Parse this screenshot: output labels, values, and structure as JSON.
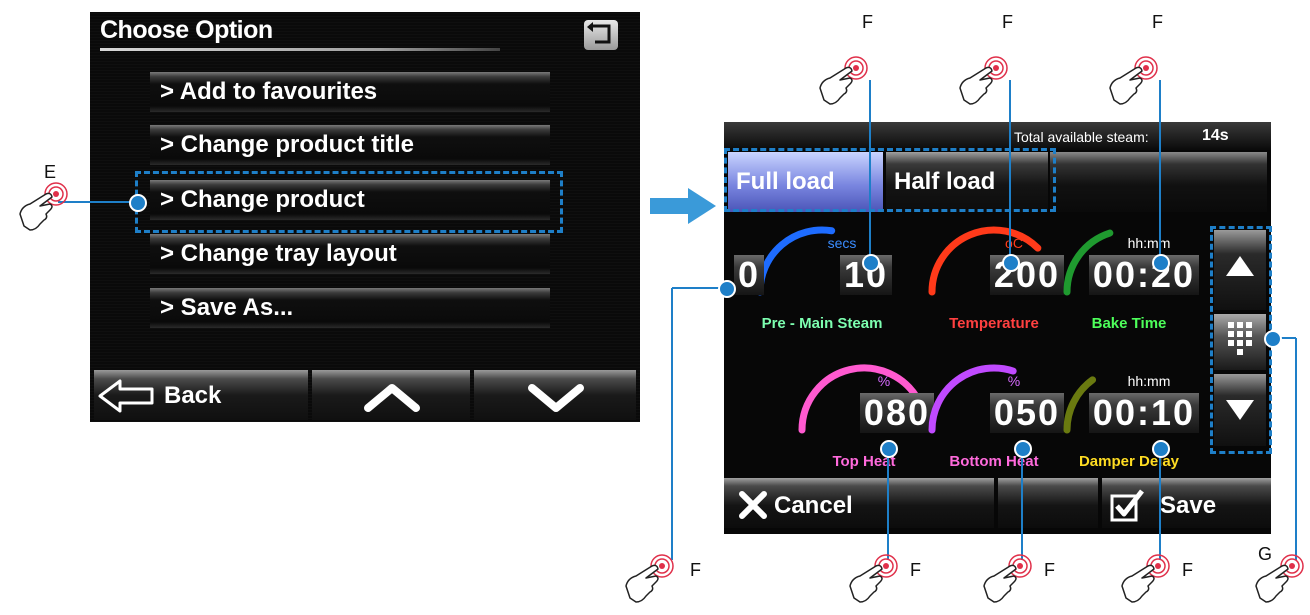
{
  "left_screen": {
    "title": "Choose Option",
    "menu_items": [
      "> Add to favourites",
      "> Change product title",
      "> Change product",
      "> Change tray layout",
      "> Save As..."
    ],
    "back_label": "Back",
    "icons": [
      "return-icon",
      "back-arrow-icon",
      "chevron-up-icon",
      "chevron-down-icon"
    ]
  },
  "right_screen": {
    "steam_label": "Total available steam:",
    "steam_value": "14s",
    "tabs": [
      "Full load",
      "Half load"
    ],
    "gauges": [
      {
        "unit": "secs",
        "value": "10",
        "label": "Pre - Main Steam",
        "prefix": "0",
        "color": "#1e6cff",
        "label_color": "#7dffb0",
        "unit_color": "#3a8cff",
        "level": 0.55
      },
      {
        "unit": "oC",
        "value": "200",
        "label": "Temperature",
        "color": "#ff3a1a",
        "label_color": "#ff4040",
        "unit_color": "#ff3a1a",
        "level": 0.75
      },
      {
        "unit": "hh:mm",
        "value": "00:20",
        "label": "Bake Time",
        "color": "#1f9a2f",
        "label_color": "#4dff5a",
        "unit_color": "#ffffff",
        "level": 0.4
      },
      {
        "unit": "%",
        "value": "080",
        "label": "Top Heat",
        "color": "#ff5ad0",
        "label_color": "#ff6adc",
        "unit_color": "#d86aff",
        "level": 0.85
      },
      {
        "unit": "%",
        "value": "050",
        "label": "Bottom Heat",
        "color": "#c04aff",
        "label_color": "#ff6adc",
        "unit_color": "#d86aff",
        "level": 0.6
      },
      {
        "unit": "hh:mm",
        "value": "00:10",
        "label": "Damper Delay",
        "color": "#6a7a10",
        "label_color": "#ffdd22",
        "unit_color": "#ffffff",
        "level": 0.3
      }
    ],
    "cancel_label": "Cancel",
    "save_label": "Save",
    "icons": [
      "arrow-up-icon",
      "keypad-icon",
      "arrow-down-icon",
      "cancel-x-icon",
      "save-check-icon"
    ]
  },
  "annotations": {
    "e_label": "E",
    "f_label": "F",
    "g_label": "G",
    "highlight_color": "#1e7fc8",
    "arrow_color": "#3a9ad9"
  }
}
